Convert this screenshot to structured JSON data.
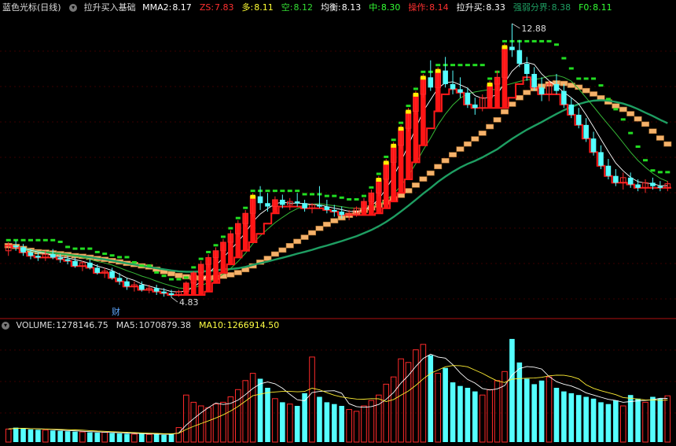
{
  "main_header": {
    "title": "蓝色光标(日线)",
    "indicator_name": "拉升买入基础",
    "items": [
      {
        "label": "MMA2:",
        "value": "8.17",
        "color": "#ffffff"
      },
      {
        "label": "ZS:",
        "value": "7.83",
        "color": "#ff3030"
      },
      {
        "label": "多:",
        "value": "8.11",
        "color": "#ffff33"
      },
      {
        "label": "空:",
        "value": "8.12",
        "color": "#33dd33"
      },
      {
        "label": "均衡:",
        "value": "8.13",
        "color": "#ffffff"
      },
      {
        "label": "中:",
        "value": "8.30",
        "color": "#33ff33"
      },
      {
        "label": "操作:",
        "value": "8.14",
        "color": "#ff3030"
      },
      {
        "label": "拉升买:",
        "value": "8.33",
        "color": "#ffffff"
      },
      {
        "label": "强弱分界:",
        "value": "8.38",
        "color": "#1e9e62"
      },
      {
        "label": "F0:",
        "value": "8.11",
        "color": "#33ff33"
      }
    ]
  },
  "price_annotations": {
    "high": "12.88",
    "low": "4.83",
    "marker": "财"
  },
  "volume_header": {
    "items": [
      {
        "label": "VOLUME:",
        "value": "1278146.75",
        "color": "#dddddd"
      },
      {
        "label": "MA5:",
        "value": "1070879.38",
        "color": "#dddddd"
      },
      {
        "label": "MA10:",
        "value": "1266914.50",
        "color": "#ffff44"
      }
    ]
  },
  "colors": {
    "up": "#ff2a2a",
    "down": "#55ffff",
    "ma_green": "#1e9e62",
    "orange": "#f5b26b",
    "dots": "#22dd22",
    "yellow": "#ffee00"
  },
  "chart_data": [
    {
      "type": "candlestick",
      "title": "蓝色光标(日线)",
      "y_range": [
        4.83,
        12.88
      ],
      "bars": [
        {
          "o": 6.2,
          "h": 6.45,
          "l": 6.05,
          "c": 6.35
        },
        {
          "o": 6.35,
          "h": 6.5,
          "l": 6.2,
          "c": 6.3
        },
        {
          "o": 6.3,
          "h": 6.4,
          "l": 6.05,
          "c": 6.15
        },
        {
          "o": 6.15,
          "h": 6.25,
          "l": 5.95,
          "c": 6.05
        },
        {
          "o": 6.05,
          "h": 6.15,
          "l": 5.9,
          "c": 6.0
        },
        {
          "o": 6.0,
          "h": 6.2,
          "l": 5.9,
          "c": 6.1
        },
        {
          "o": 6.1,
          "h": 6.25,
          "l": 5.95,
          "c": 6.0
        },
        {
          "o": 6.0,
          "h": 6.1,
          "l": 5.85,
          "c": 5.95
        },
        {
          "o": 5.95,
          "h": 6.05,
          "l": 5.8,
          "c": 5.9
        },
        {
          "o": 5.9,
          "h": 6.0,
          "l": 5.7,
          "c": 5.75
        },
        {
          "o": 5.75,
          "h": 5.9,
          "l": 5.6,
          "c": 5.85
        },
        {
          "o": 5.85,
          "h": 5.95,
          "l": 5.65,
          "c": 5.7
        },
        {
          "o": 5.7,
          "h": 5.8,
          "l": 5.5,
          "c": 5.55
        },
        {
          "o": 5.55,
          "h": 5.7,
          "l": 5.4,
          "c": 5.6
        },
        {
          "o": 5.6,
          "h": 5.7,
          "l": 5.35,
          "c": 5.4
        },
        {
          "o": 5.4,
          "h": 5.55,
          "l": 5.2,
          "c": 5.3
        },
        {
          "o": 5.3,
          "h": 5.4,
          "l": 5.05,
          "c": 5.15
        },
        {
          "o": 5.15,
          "h": 5.3,
          "l": 5.0,
          "c": 5.2
        },
        {
          "o": 5.2,
          "h": 5.3,
          "l": 5.0,
          "c": 5.05
        },
        {
          "o": 5.05,
          "h": 5.2,
          "l": 4.95,
          "c": 5.1
        },
        {
          "o": 5.1,
          "h": 5.2,
          "l": 4.9,
          "c": 5.0
        },
        {
          "o": 5.0,
          "h": 5.1,
          "l": 4.85,
          "c": 4.95
        },
        {
          "o": 4.95,
          "h": 5.05,
          "l": 4.83,
          "c": 4.9
        },
        {
          "o": 4.9,
          "h": 5.05,
          "l": 4.85,
          "c": 5.0
        },
        {
          "o": 5.0,
          "h": 5.3,
          "l": 4.95,
          "c": 5.25
        },
        {
          "o": 5.25,
          "h": 5.6,
          "l": 5.2,
          "c": 5.55
        },
        {
          "o": 5.55,
          "h": 5.9,
          "l": 5.45,
          "c": 5.8
        },
        {
          "o": 5.8,
          "h": 6.1,
          "l": 5.7,
          "c": 6.0
        },
        {
          "o": 6.0,
          "h": 6.3,
          "l": 5.9,
          "c": 6.2
        },
        {
          "o": 6.2,
          "h": 6.55,
          "l": 6.1,
          "c": 6.45
        },
        {
          "o": 6.45,
          "h": 6.8,
          "l": 6.35,
          "c": 6.7
        },
        {
          "o": 6.7,
          "h": 7.1,
          "l": 6.6,
          "c": 7.0
        },
        {
          "o": 7.0,
          "h": 7.4,
          "l": 6.9,
          "c": 7.3
        },
        {
          "o": 7.3,
          "h": 7.9,
          "l": 7.2,
          "c": 7.8
        },
        {
          "o": 7.8,
          "h": 8.1,
          "l": 7.4,
          "c": 7.6
        },
        {
          "o": 7.6,
          "h": 7.9,
          "l": 7.35,
          "c": 7.5
        },
        {
          "o": 7.5,
          "h": 7.8,
          "l": 7.4,
          "c": 7.7
        },
        {
          "o": 7.7,
          "h": 7.85,
          "l": 7.45,
          "c": 7.55
        },
        {
          "o": 7.55,
          "h": 7.75,
          "l": 7.4,
          "c": 7.65
        },
        {
          "o": 7.65,
          "h": 7.9,
          "l": 7.5,
          "c": 7.6
        },
        {
          "o": 7.6,
          "h": 7.7,
          "l": 7.35,
          "c": 7.45
        },
        {
          "o": 7.45,
          "h": 7.6,
          "l": 7.3,
          "c": 7.55
        },
        {
          "o": 7.55,
          "h": 8.1,
          "l": 7.45,
          "c": 7.5
        },
        {
          "o": 7.5,
          "h": 7.7,
          "l": 7.3,
          "c": 7.4
        },
        {
          "o": 7.4,
          "h": 7.55,
          "l": 7.2,
          "c": 7.35
        },
        {
          "o": 7.35,
          "h": 7.5,
          "l": 7.15,
          "c": 7.25
        },
        {
          "o": 7.25,
          "h": 7.4,
          "l": 7.1,
          "c": 7.3
        },
        {
          "o": 7.3,
          "h": 7.5,
          "l": 7.2,
          "c": 7.45
        },
        {
          "o": 7.45,
          "h": 7.75,
          "l": 7.35,
          "c": 7.65
        },
        {
          "o": 7.65,
          "h": 8.0,
          "l": 7.55,
          "c": 7.9
        },
        {
          "o": 7.9,
          "h": 8.4,
          "l": 7.8,
          "c": 8.3
        },
        {
          "o": 8.3,
          "h": 8.9,
          "l": 8.2,
          "c": 8.8
        },
        {
          "o": 8.8,
          "h": 9.4,
          "l": 8.7,
          "c": 9.3
        },
        {
          "o": 9.3,
          "h": 9.9,
          "l": 9.2,
          "c": 9.8
        },
        {
          "o": 9.8,
          "h": 10.4,
          "l": 9.7,
          "c": 10.3
        },
        {
          "o": 10.3,
          "h": 10.9,
          "l": 10.2,
          "c": 10.8
        },
        {
          "o": 10.8,
          "h": 11.4,
          "l": 10.7,
          "c": 11.3
        },
        {
          "o": 11.3,
          "h": 11.8,
          "l": 10.9,
          "c": 11.0
        },
        {
          "o": 11.0,
          "h": 11.6,
          "l": 10.85,
          "c": 11.5
        },
        {
          "o": 11.5,
          "h": 11.9,
          "l": 11.0,
          "c": 11.1
        },
        {
          "o": 11.1,
          "h": 11.5,
          "l": 10.8,
          "c": 10.95
        },
        {
          "o": 10.95,
          "h": 11.3,
          "l": 10.7,
          "c": 10.85
        },
        {
          "o": 10.85,
          "h": 11.0,
          "l": 10.4,
          "c": 10.5
        },
        {
          "o": 10.5,
          "h": 10.7,
          "l": 10.2,
          "c": 10.4
        },
        {
          "o": 10.4,
          "h": 10.8,
          "l": 10.3,
          "c": 10.7
        },
        {
          "o": 10.7,
          "h": 11.2,
          "l": 10.6,
          "c": 11.1
        },
        {
          "o": 11.1,
          "h": 11.5,
          "l": 10.9,
          "c": 11.3
        },
        {
          "o": 11.3,
          "h": 12.3,
          "l": 11.2,
          "c": 12.2
        },
        {
          "o": 12.2,
          "h": 12.88,
          "l": 11.9,
          "c": 12.1
        },
        {
          "o": 12.1,
          "h": 12.4,
          "l": 11.6,
          "c": 11.7
        },
        {
          "o": 11.7,
          "h": 11.9,
          "l": 11.2,
          "c": 11.4
        },
        {
          "o": 11.4,
          "h": 11.6,
          "l": 10.9,
          "c": 11.0
        },
        {
          "o": 11.0,
          "h": 11.3,
          "l": 10.6,
          "c": 10.8
        },
        {
          "o": 10.8,
          "h": 11.2,
          "l": 10.6,
          "c": 11.1
        },
        {
          "o": 11.1,
          "h": 11.4,
          "l": 10.8,
          "c": 10.9
        },
        {
          "o": 10.9,
          "h": 11.1,
          "l": 10.4,
          "c": 10.5
        },
        {
          "o": 10.5,
          "h": 10.7,
          "l": 10.1,
          "c": 10.2
        },
        {
          "o": 10.2,
          "h": 10.4,
          "l": 9.8,
          "c": 9.9
        },
        {
          "o": 9.9,
          "h": 10.1,
          "l": 9.4,
          "c": 9.5
        },
        {
          "o": 9.5,
          "h": 9.7,
          "l": 9.0,
          "c": 9.1
        },
        {
          "o": 9.1,
          "h": 9.3,
          "l": 8.6,
          "c": 8.7
        },
        {
          "o": 8.7,
          "h": 8.9,
          "l": 8.3,
          "c": 8.4
        },
        {
          "o": 8.4,
          "h": 8.6,
          "l": 8.1,
          "c": 8.2
        },
        {
          "o": 8.2,
          "h": 8.5,
          "l": 8.0,
          "c": 8.35
        },
        {
          "o": 8.35,
          "h": 8.5,
          "l": 8.05,
          "c": 8.15
        },
        {
          "o": 8.15,
          "h": 8.3,
          "l": 7.95,
          "c": 8.05
        },
        {
          "o": 8.05,
          "h": 8.3,
          "l": 7.9,
          "c": 8.2
        },
        {
          "o": 8.2,
          "h": 8.35,
          "l": 8.0,
          "c": 8.1
        },
        {
          "o": 8.1,
          "h": 8.25,
          "l": 7.95,
          "c": 8.05
        },
        {
          "o": 8.05,
          "h": 8.25,
          "l": 7.95,
          "c": 8.17
        }
      ]
    },
    {
      "type": "bar",
      "title": "VOLUME",
      "y_range": [
        0,
        3000000
      ],
      "values": [
        360000,
        400000,
        380000,
        350000,
        340000,
        330000,
        320000,
        310000,
        300000,
        290000,
        280000,
        270000,
        260000,
        270000,
        250000,
        240000,
        230000,
        220000,
        230000,
        210000,
        220000,
        200000,
        230000,
        400000,
        1300000,
        1100000,
        1000000,
        950000,
        1050000,
        1100000,
        1250000,
        1450000,
        1700000,
        1900000,
        1750000,
        1500000,
        1200000,
        1100000,
        1050000,
        1000000,
        1350000,
        2350000,
        1250000,
        1100000,
        1050000,
        1000000,
        900000,
        850000,
        1000000,
        1150000,
        1300000,
        1600000,
        1800000,
        2300000,
        2200000,
        2550000,
        2700000,
        2400000,
        1900000,
        2050000,
        1650000,
        1550000,
        1500000,
        1400000,
        1300000,
        1450000,
        1700000,
        1950000,
        2850000,
        2200000,
        1750000,
        1600000,
        1700000,
        1800000,
        1500000,
        1400000,
        1350000,
        1300000,
        1250000,
        1200000,
        1100000,
        1050000,
        1150000,
        1000000,
        1300000,
        1200000,
        1100000,
        1250000,
        1200000,
        1278146
      ]
    }
  ]
}
